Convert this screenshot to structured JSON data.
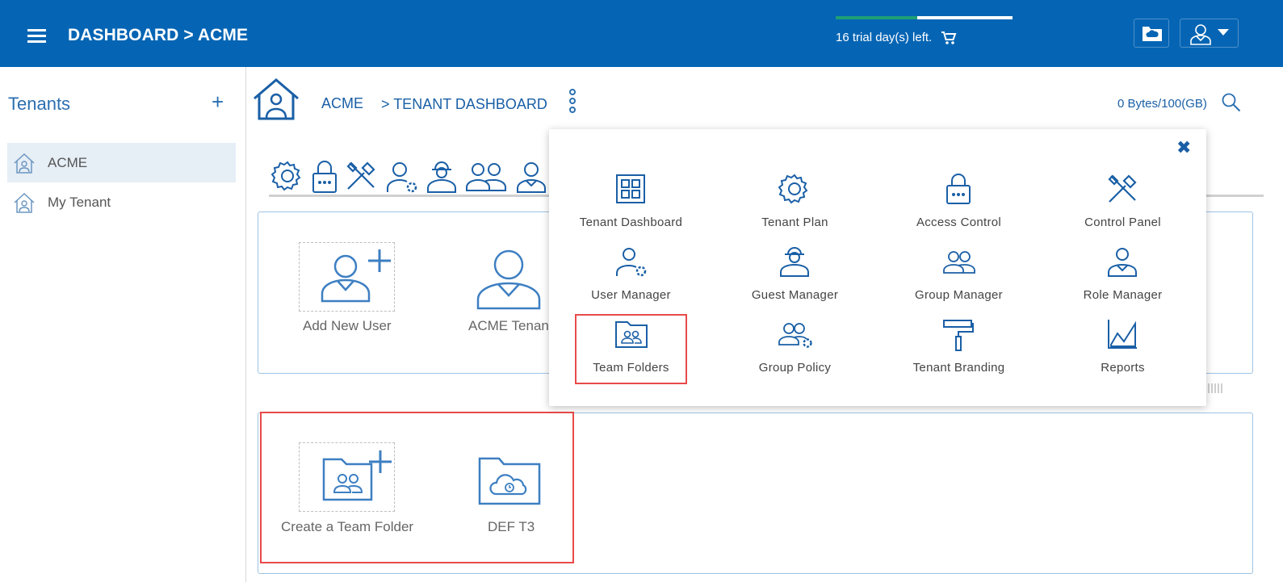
{
  "header": {
    "title": "DASHBOARD > ACME",
    "trial_text": "16 trial day(s) left.",
    "trial_progress": 0.46,
    "menu_icon": "hamburger-icon",
    "cart_icon": "cart-icon",
    "cloud_folder_icon": "cloud-folder-icon",
    "user_icon": "user-icon"
  },
  "sidebar": {
    "title": "Tenants",
    "add_label": "+",
    "items": [
      {
        "label": "ACME",
        "active": true
      },
      {
        "label": "My Tenant",
        "active": false
      }
    ]
  },
  "breadcrumb": {
    "root": "ACME",
    "current": "> TENANT DASHBOARD"
  },
  "storage": "0 Bytes/100(GB)",
  "toolbar_icons": [
    "gear-icon",
    "lock-icon",
    "tools-icon",
    "user-manager-icon",
    "guest-icon",
    "group-icon",
    "role-icon"
  ],
  "users_panel": {
    "tiles": [
      {
        "label": "Add New User"
      },
      {
        "label": "ACME Tenant"
      }
    ]
  },
  "folders_panel": {
    "tiles": [
      {
        "label": "Create a Team Folder"
      },
      {
        "label": "DEF T3"
      }
    ]
  },
  "dropdown": {
    "close_label": "✖",
    "items": [
      {
        "label": "Tenant Dashboard",
        "icon": "grid-icon"
      },
      {
        "label": "Tenant Plan",
        "icon": "gear-icon"
      },
      {
        "label": "Access Control",
        "icon": "lock-icon"
      },
      {
        "label": "Control Panel",
        "icon": "tools-icon"
      },
      {
        "label": "User Manager",
        "icon": "user-gear-icon"
      },
      {
        "label": "Guest Manager",
        "icon": "guest-icon"
      },
      {
        "label": "Group Manager",
        "icon": "group-icon"
      },
      {
        "label": "Role Manager",
        "icon": "role-icon"
      },
      {
        "label": "Team Folders",
        "icon": "team-folder-icon"
      },
      {
        "label": "Group Policy",
        "icon": "group-policy-icon"
      },
      {
        "label": "Tenant Branding",
        "icon": "paint-roller-icon"
      },
      {
        "label": "Reports",
        "icon": "chart-icon"
      }
    ]
  },
  "colors": {
    "header_bg": "#0565b4",
    "accent": "#2a6fb0",
    "highlight": "#e84a4a",
    "progress": "#1e9e75"
  }
}
